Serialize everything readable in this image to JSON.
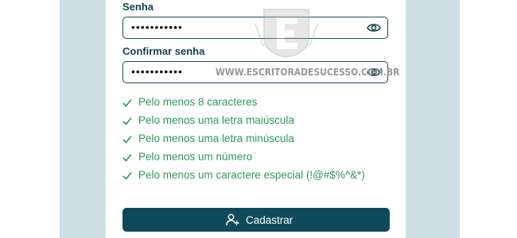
{
  "form": {
    "password_label": "Senha",
    "password_value": "•••••••••••",
    "confirm_label": "Confirmar senha",
    "confirm_value": "•••••••••••",
    "password_toggle_icon": "eye-icon",
    "confirm_toggle_icon": "eye-icon"
  },
  "requirements": [
    {
      "text": "Pelo menos 8 caracteres",
      "met": true
    },
    {
      "text": "Pelo menos uma letra maiúscula",
      "met": true
    },
    {
      "text": "Pelo menos uma letra minúscula",
      "met": true
    },
    {
      "text": "Pelo menos um número",
      "met": true
    },
    {
      "text": "Pelo menos um caractere especial (!@#$%^&*)",
      "met": true
    }
  ],
  "submit": {
    "label": "Cadastrar",
    "icon": "user-plus-icon"
  },
  "watermark": {
    "text": "WWW.ESCRITORADESUCESSO.COM.BR"
  },
  "colors": {
    "accent": "#0f4a5a",
    "success": "#2c9a52",
    "backdrop": "#cfdfe6"
  }
}
